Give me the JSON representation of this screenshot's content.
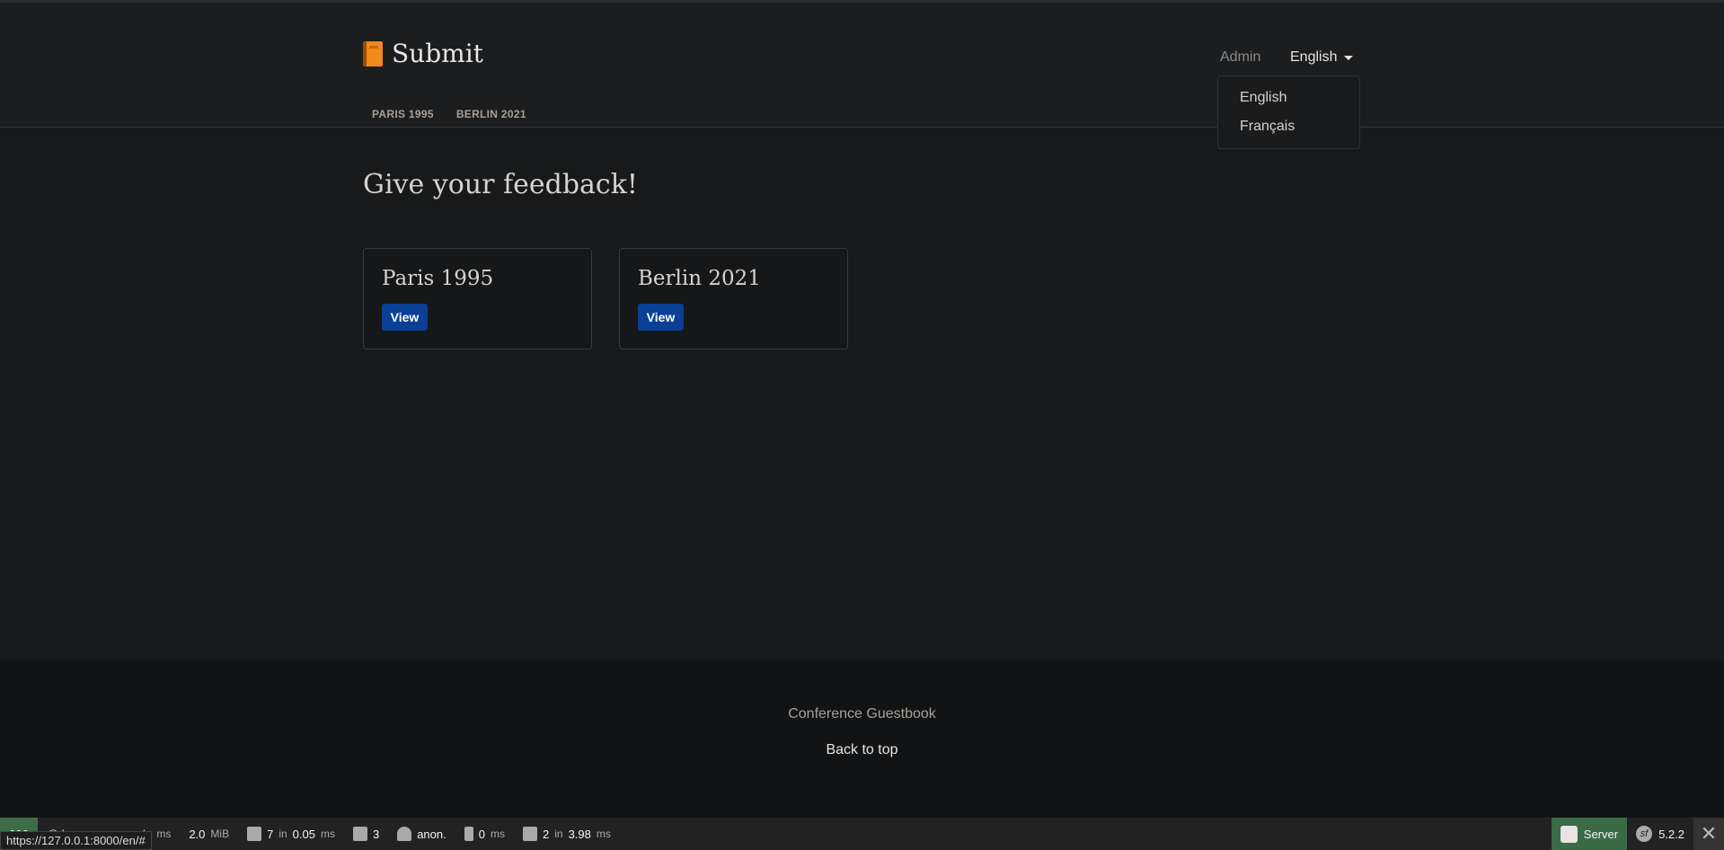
{
  "header": {
    "brand": "Submit",
    "brand_icon": "orange-book-icon",
    "nav": [
      "PARIS 1995",
      "BERLIN 2021"
    ],
    "admin": "Admin",
    "language": "English"
  },
  "dropdown": {
    "items": [
      "English",
      "Français"
    ]
  },
  "main": {
    "title": "Give your feedback!",
    "cards": [
      {
        "title": "Paris 1995",
        "button": "View"
      },
      {
        "title": "Berlin 2021",
        "button": "View"
      }
    ]
  },
  "footer": {
    "name": "Conference Guestbook",
    "back_to_top": "Back to top"
  },
  "toolbar": {
    "status": "200",
    "route": "@ homepage",
    "time": "n/a",
    "time_unit": "ms",
    "memory": "2.0",
    "memory_unit": "MiB",
    "cache_count": "7",
    "cache_in": "in",
    "cache_time": "0.05",
    "cache_unit": "ms",
    "translations": "3",
    "user": "anon.",
    "events_time": "0",
    "events_unit": "ms",
    "db_count": "2",
    "db_in": "in",
    "db_time": "3.98",
    "db_unit": "ms",
    "server": "Server",
    "version": "5.2.2",
    "url_tooltip": "https://127.0.0.1:8000/en/#"
  },
  "colors": {
    "button": "#0a4096",
    "status": "#3c6d46",
    "brand_icon": "#f08a1c"
  }
}
